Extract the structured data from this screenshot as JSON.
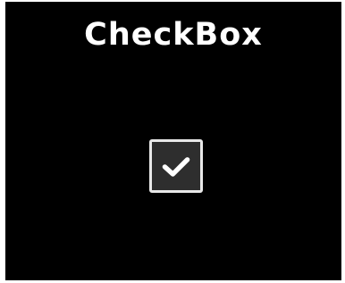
{
  "screen": {
    "title": "CheckBox",
    "background": "#000000"
  },
  "checkbox": {
    "checked": true,
    "icon": "check-icon",
    "box_color": "#2e2e2e",
    "border_color": "#e8e8e8",
    "check_color": "#ffffff"
  }
}
